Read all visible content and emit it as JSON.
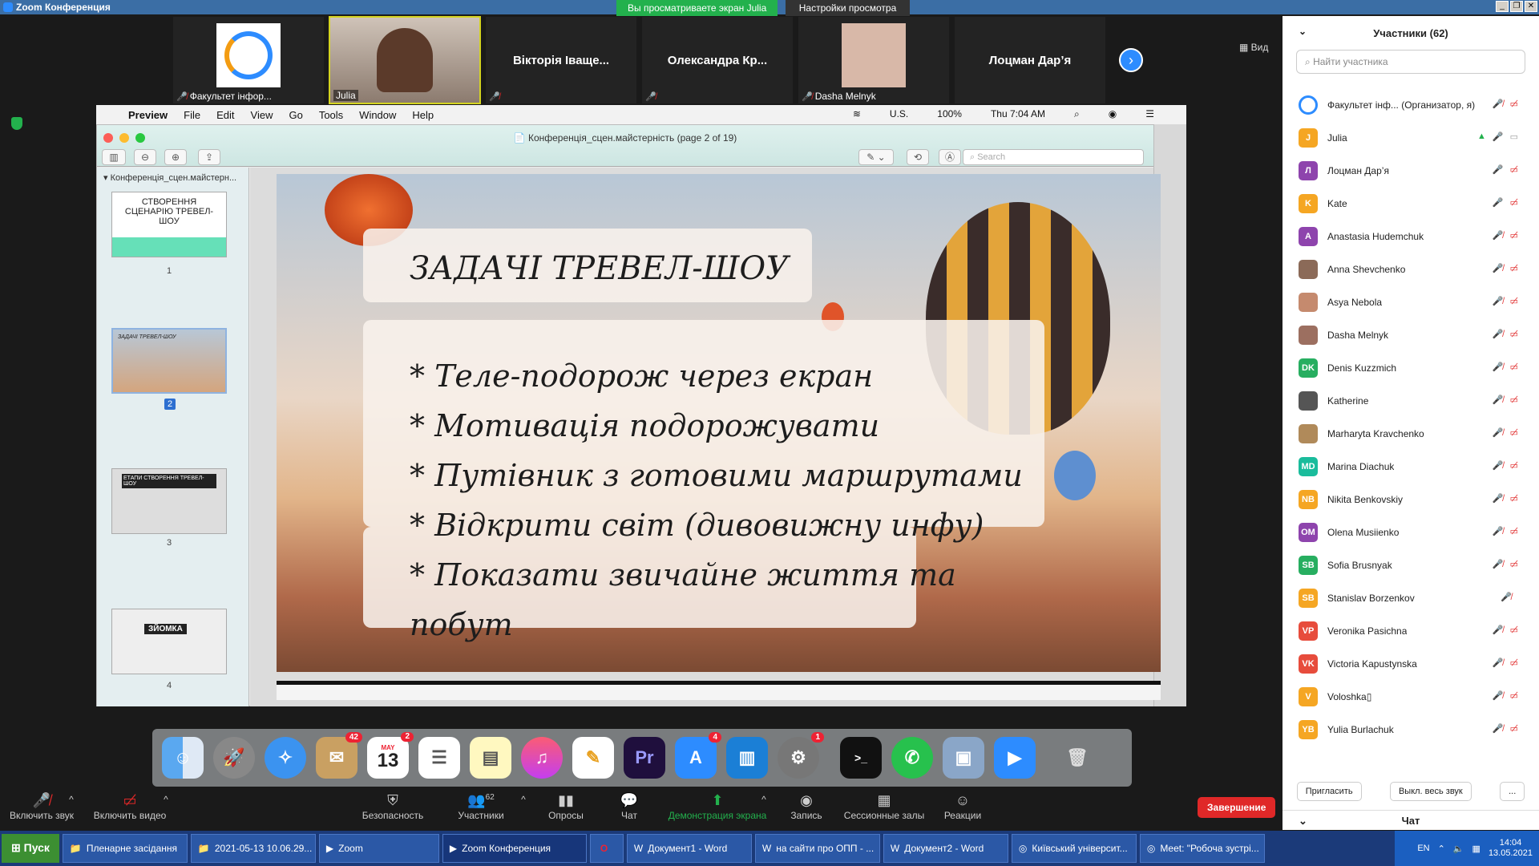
{
  "window": {
    "title": "Zoom Конференция"
  },
  "share_banner": "Вы просматриваете экран Julia",
  "view_options": "Настройки просмотра",
  "view_button": "Вид",
  "video_strip": [
    {
      "name": "Факультет інфор..."
    },
    {
      "name": "Julia"
    },
    {
      "name": "Вікторія Іваще..."
    },
    {
      "name": "Олександра Кр..."
    },
    {
      "name": "Dasha Melnyk"
    },
    {
      "name": "Лоцман Дар’я"
    }
  ],
  "mac": {
    "menu": [
      "Preview",
      "File",
      "Edit",
      "View",
      "Go",
      "Tools",
      "Window",
      "Help"
    ],
    "status_input": "U.S.",
    "status_battery": "100%",
    "status_time": "Thu 7:04 AM"
  },
  "preview": {
    "title": "Конференція_сцен.майстерність  (page 2 of 19)",
    "search_placeholder": "Search",
    "sidebar_title": "Конференція_сцен.майстерн...",
    "thumbs": [
      {
        "num": "1",
        "text": "СТВОРЕННЯ СЦЕНАРІЮ ТРЕВЕЛ-ШОУ"
      },
      {
        "num": "2",
        "text": "ЗАДАЧІ ТРЕВЕЛ-ШОУ"
      },
      {
        "num": "3",
        "text": "ЕТАПИ СТВОРЕННЯ ТРЕВЕЛ-ШОУ"
      },
      {
        "num": "4",
        "text": "ЗЙОМКА"
      }
    ]
  },
  "slide": {
    "title": "ЗАДАЧІ ТРЕВЕЛ-ШОУ",
    "bullets": [
      "* Теле-подорож через екран",
      "* Мотивація подорожувати",
      "* Путівник з готовими маршрутами",
      "* Відкрити світ (дивовижну инфу)",
      "* Показати звичайне життя та",
      "побут"
    ]
  },
  "dock_badges": {
    "mail": "42",
    "calendar": "2",
    "calendar_day": "13",
    "calendar_month": "MAY",
    "appstore": "4",
    "prefs": "1"
  },
  "participants": {
    "header": "Участники (62)",
    "search_placeholder": "Найти участника",
    "list": [
      {
        "name": "Факультет інф... (Организатор, я)",
        "initials": "",
        "color": "#2d8cff"
      },
      {
        "name": "Julia",
        "initials": "J",
        "color": "#f5a623"
      },
      {
        "name": "Лоцман Дар’я",
        "initials": "Л",
        "color": "#8e44ad"
      },
      {
        "name": "Kate",
        "initials": "K",
        "color": "#f5a623"
      },
      {
        "name": "Anastasia Hudemchuk",
        "initials": "A",
        "color": "#8e44ad"
      },
      {
        "name": "Anna Shevchenko",
        "initials": "",
        "color": "#8b6a58"
      },
      {
        "name": "Asya Nebola",
        "initials": "",
        "color": "#c58a6e"
      },
      {
        "name": "Dasha Melnyk",
        "initials": "",
        "color": "#9c6f60"
      },
      {
        "name": "Denis Kuzzmich",
        "initials": "DK",
        "color": "#27ae60"
      },
      {
        "name": "Katherine",
        "initials": "",
        "color": "#555555"
      },
      {
        "name": "Marharyta Kravchenko",
        "initials": "",
        "color": "#b08a5a"
      },
      {
        "name": "Marina Diachuk",
        "initials": "MD",
        "color": "#1abc9c"
      },
      {
        "name": "Nikita Benkovskiy",
        "initials": "NB",
        "color": "#f5a623"
      },
      {
        "name": "Olena Musiienko",
        "initials": "OM",
        "color": "#8e44ad"
      },
      {
        "name": "Sofia Brusnyak",
        "initials": "SB",
        "color": "#27ae60"
      },
      {
        "name": "Stanislav Borzenkov",
        "initials": "SB",
        "color": "#f5a623"
      },
      {
        "name": "Veronika Pasichna",
        "initials": "VP",
        "color": "#e74c3c"
      },
      {
        "name": "Victoria Kapustynska",
        "initials": "VK",
        "color": "#e74c3c"
      },
      {
        "name": "Voloshka▯",
        "initials": "V",
        "color": "#f5a623"
      },
      {
        "name": "Yulia Burlachuk",
        "initials": "YB",
        "color": "#f5a623"
      }
    ],
    "invite": "Пригласить",
    "mute_all": "Выкл. весь звук",
    "more": "...",
    "chat": "Чат"
  },
  "controls": {
    "audio": "Включить звук",
    "video": "Включить видео",
    "security": "Безопасность",
    "participants": "Участники",
    "participants_count": "62",
    "polls": "Опросы",
    "chat": "Чат",
    "share": "Демонстрация экрана",
    "record": "Запись",
    "breakout": "Сессионные залы",
    "reactions": "Реакции",
    "end": "Завершение"
  },
  "taskbar": {
    "start": "Пуск",
    "items": [
      "Пленарне засідання",
      "2021-05-13 10.06.29...",
      "Zoom",
      "Zoom Конференция",
      "",
      "Документ1 - Word",
      "на сайти про ОПП - ...",
      "Документ2 - Word",
      "Київський університ...",
      "Meet: \"Робоча зустрі..."
    ],
    "lang": "EN",
    "time": "14:04",
    "date": "13.05.2021"
  },
  "colors": {
    "zoom_blue": "#2d8cff",
    "share_green": "#23b14d",
    "end_red": "#e02828",
    "mute_red": "#e02828"
  }
}
